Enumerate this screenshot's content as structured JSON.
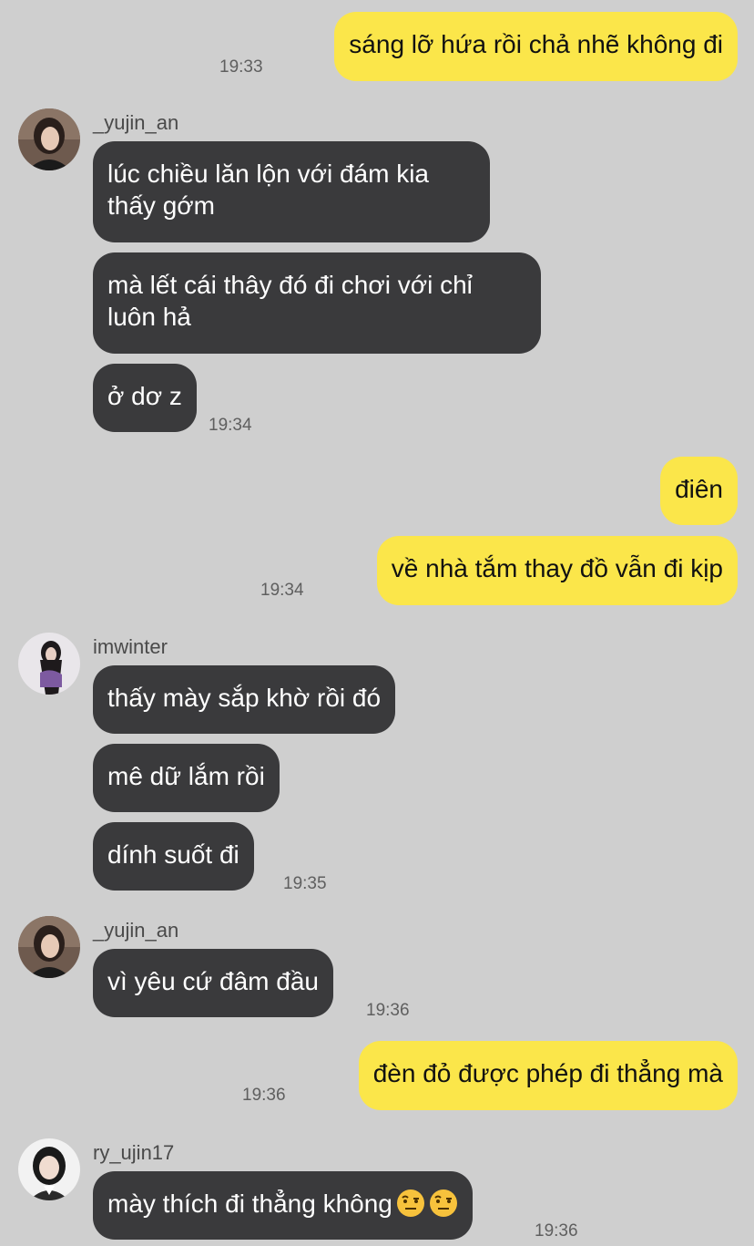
{
  "messages": {
    "m1": {
      "text": "sáng lỡ hứa rồi chả nhẽ không đi",
      "time": "19:33"
    },
    "g1": {
      "sender": "_yujin_an",
      "b1": "lúc chiều lăn lộn với đám kia thấy gớm",
      "b2": "mà lết cái thây đó đi chơi với chỉ luôn hả",
      "b3": "ở dơ z",
      "time": "19:34"
    },
    "m2": {
      "b1": "điên",
      "b2": "về nhà tắm thay đồ vẫn đi kịp",
      "time": "19:34"
    },
    "g2": {
      "sender": "imwinter",
      "b1": "thấy mày sắp khờ rồi đó",
      "b2": "mê dữ lắm rồi",
      "b3": "dính suốt đi",
      "time": "19:35"
    },
    "g3": {
      "sender": "_yujin_an",
      "b1": "vì yêu cứ đâm đầu",
      "time": "19:36"
    },
    "m3": {
      "text": "đèn đỏ được phép đi thẳng mà",
      "time": "19:36"
    },
    "g4": {
      "sender": "ry_ujin17",
      "b1": "mày thích đi thẳng không",
      "emoji": "raised-eyebrow-emoji",
      "time": "19:36"
    }
  },
  "colors": {
    "background": "#cfcfcf",
    "incoming_bubble": "#3a3a3c",
    "outgoing_bubble": "#fbe64a"
  }
}
